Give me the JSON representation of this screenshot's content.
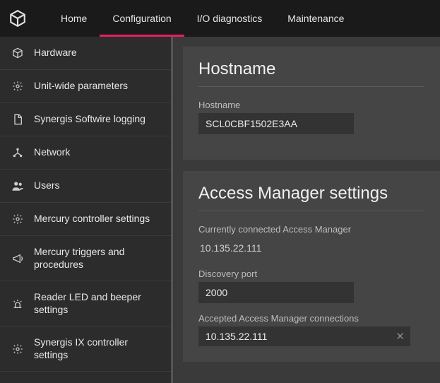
{
  "nav": {
    "tabs": [
      {
        "label": "Home"
      },
      {
        "label": "Configuration"
      },
      {
        "label": "I/O diagnostics"
      },
      {
        "label": "Maintenance"
      }
    ],
    "activeIndex": 1
  },
  "sidebar": {
    "items": [
      {
        "label": "Hardware",
        "icon": "cube-icon"
      },
      {
        "label": "Unit-wide parameters",
        "icon": "gear-icon"
      },
      {
        "label": "Synergis Softwire logging",
        "icon": "file-icon"
      },
      {
        "label": "Network",
        "icon": "network-icon"
      },
      {
        "label": "Users",
        "icon": "users-icon"
      },
      {
        "label": "Mercury controller settings",
        "icon": "gear-icon"
      },
      {
        "label": "Mercury triggers and procedures",
        "icon": "megaphone-icon"
      },
      {
        "label": "Reader LED and beeper settings",
        "icon": "siren-icon"
      },
      {
        "label": "Synergis IX controller settings",
        "icon": "gear-icon"
      }
    ]
  },
  "main": {
    "hostname_panel": {
      "title": "Hostname",
      "hostname_label": "Hostname",
      "hostname_value": "SCL0CBF1502E3AA"
    },
    "am_panel": {
      "title": "Access Manager settings",
      "connected_label": "Currently connected Access Manager",
      "connected_value": "10.135.22.111",
      "discovery_label": "Discovery port",
      "discovery_value": "2000",
      "accepted_label": "Accepted Access Manager connections",
      "accepted_value": "10.135.22.111"
    }
  }
}
